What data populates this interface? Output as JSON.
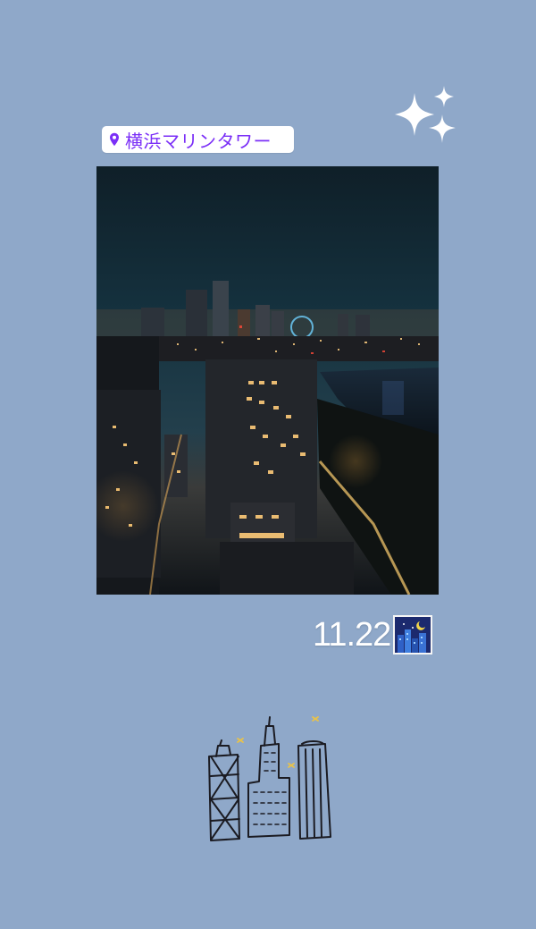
{
  "location": {
    "label": "横浜マリンタワー",
    "icon": "location-pin-icon",
    "text_color": "#7b2ff7"
  },
  "date": {
    "text": "11.22",
    "emoji": "night-city-emoji-icon"
  },
  "decorations": {
    "sparkles_icon": "sparkles-icon",
    "doodle_icon": "skyscrapers-doodle-icon"
  },
  "colors": {
    "background": "#8fa8c9",
    "sticker": "#ffffff",
    "star_accent": "#e8c24a"
  }
}
